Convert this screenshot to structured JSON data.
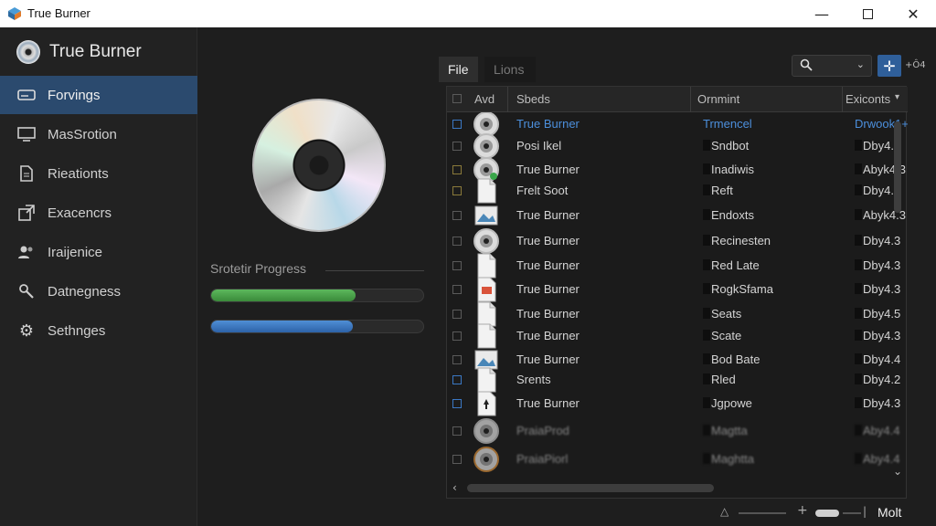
{
  "window": {
    "title": "True Burner",
    "minimize_icon": "minimize-icon",
    "maximize_icon": "maximize-icon",
    "close_icon": "close-icon"
  },
  "sidebar": {
    "brand": "True Burner",
    "items": [
      {
        "label": "Forvings",
        "icon": "drive-icon",
        "active": true
      },
      {
        "label": "MasSrotion",
        "icon": "monitor-icon",
        "active": false
      },
      {
        "label": "Rieationts",
        "icon": "document-icon",
        "active": false
      },
      {
        "label": "Exacencrs",
        "icon": "export-icon",
        "active": false
      },
      {
        "label": "Iraijenice",
        "icon": "users-icon",
        "active": false
      },
      {
        "label": "Datnegness",
        "icon": "tools-icon",
        "active": false
      },
      {
        "label": "Sethnges",
        "icon": "gear-icon",
        "active": false
      }
    ]
  },
  "progress": {
    "label": "Srotetir Progress",
    "bars": [
      {
        "fraction": 0.68,
        "color": "#4caf50"
      },
      {
        "fraction": 0.67,
        "color": "#3b78c4"
      }
    ]
  },
  "panel": {
    "tabs": [
      "File",
      "Lions"
    ],
    "search_icon": "search-icon",
    "add_label": "+Ô4",
    "columns": [
      "Avd",
      "Sbeds",
      "Ornmint",
      "Exiconts"
    ],
    "rows": [
      {
        "name": "True Burner",
        "type": "Trmencel",
        "version": "Drwook1+",
        "icon": "disc",
        "checked": true
      },
      {
        "name": "Posi Ikel",
        "type": "Sndbot",
        "version": "Dby4.3",
        "icon": "disc",
        "checked": false
      },
      {
        "name": "True Burner",
        "type": "Inadiwis",
        "version": "Abyk4.3",
        "icon": "disc-green",
        "checked": false
      },
      {
        "name": "Frelt Soot",
        "type": "Reft",
        "version": "Dby4.3",
        "icon": "file",
        "checked": false
      },
      {
        "name": "True Burner",
        "type": "Endoxts",
        "version": "Abyk4.3",
        "icon": "image",
        "checked": false
      },
      {
        "name": "True Burner",
        "type": "Recinesten",
        "version": "Dby4.3",
        "icon": "disc",
        "checked": false
      },
      {
        "name": "True Burner",
        "type": "Red Late",
        "version": "Dby4.3",
        "icon": "file",
        "checked": false
      },
      {
        "name": "True Burner",
        "type": "RogkSfama",
        "version": "Dby4.3",
        "icon": "file-red",
        "checked": false
      },
      {
        "name": "True Burner",
        "type": "Seats",
        "version": "Dby4.5",
        "icon": "file",
        "checked": false
      },
      {
        "name": "True Burner",
        "type": "Scate",
        "version": "Dby4.3",
        "icon": "file",
        "checked": false
      },
      {
        "name": "True Burner",
        "type": "Bod Bate",
        "version": "Dby4.4",
        "icon": "image",
        "checked": false
      },
      {
        "name": "Srents",
        "type": "Rled",
        "version": "Dby4.2",
        "icon": "file",
        "checked": true
      },
      {
        "name": "True Burner",
        "type": "Jgpowe",
        "version": "Dby4.3",
        "icon": "file-dark",
        "checked": true
      },
      {
        "name": "PraiaProd",
        "type": "Magtta",
        "version": "Aby4.4",
        "icon": "disc",
        "checked": false,
        "blur": true
      },
      {
        "name": "PraiaPiorl",
        "type": "Maghtta",
        "version": "Aby4.4",
        "icon": "disc-orange",
        "checked": false,
        "blur": true
      }
    ]
  },
  "statusbar": {
    "label": "Molt"
  }
}
